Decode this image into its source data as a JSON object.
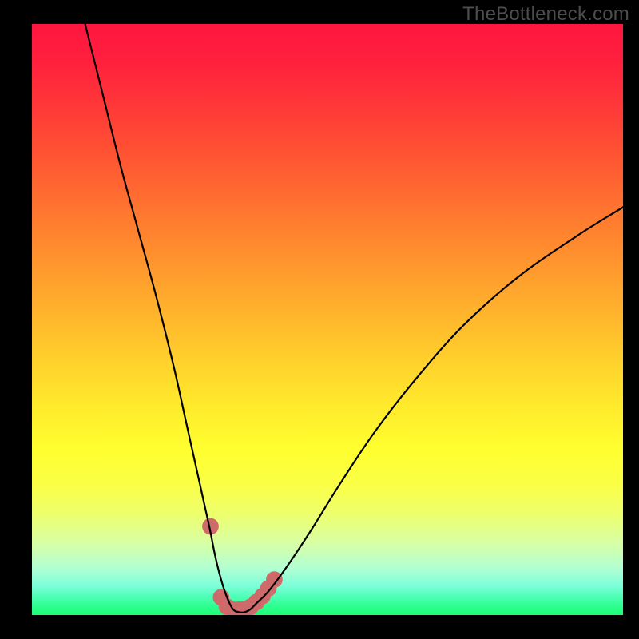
{
  "watermark": {
    "text": "TheBottleneck.com"
  },
  "colors": {
    "frame": "#000000",
    "curve": "#000000",
    "marker": "#cf6a6a",
    "watermark": "#4d4d4d",
    "gradient_top": "#ff163e",
    "gradient_bottom": "#1cff78"
  },
  "chart_data": {
    "type": "line",
    "title": "",
    "xlabel": "",
    "ylabel": "",
    "xlim": [
      0,
      100
    ],
    "ylim": [
      0,
      100
    ],
    "grid": false,
    "legend": false,
    "series": [
      {
        "name": "bottleneck-curve",
        "x": [
          9,
          12,
          15,
          18,
          21,
          24,
          26,
          28,
          30,
          31,
          32,
          33,
          34,
          35,
          36,
          37,
          38,
          40,
          43,
          47,
          52,
          58,
          65,
          73,
          82,
          92,
          100
        ],
        "y": [
          100,
          88,
          76,
          65,
          54,
          42,
          33,
          24,
          15,
          10,
          6,
          3,
          1,
          0.5,
          0.5,
          1,
          2,
          4,
          8,
          14,
          22,
          31,
          40,
          49,
          57,
          64,
          69
        ]
      }
    ],
    "markers": {
      "name": "highlight-dots",
      "points": [
        {
          "x": 30.2,
          "y": 15
        },
        {
          "x": 32.0,
          "y": 3.0
        },
        {
          "x": 33.0,
          "y": 1.4
        },
        {
          "x": 34.0,
          "y": 0.9
        },
        {
          "x": 35.0,
          "y": 0.9
        },
        {
          "x": 36.0,
          "y": 1.0
        },
        {
          "x": 37.0,
          "y": 1.4
        },
        {
          "x": 38.0,
          "y": 2.2
        },
        {
          "x": 39.0,
          "y": 3.2
        },
        {
          "x": 40.0,
          "y": 4.5
        },
        {
          "x": 41.0,
          "y": 6.0
        }
      ],
      "radius_pct": 1.4
    }
  }
}
